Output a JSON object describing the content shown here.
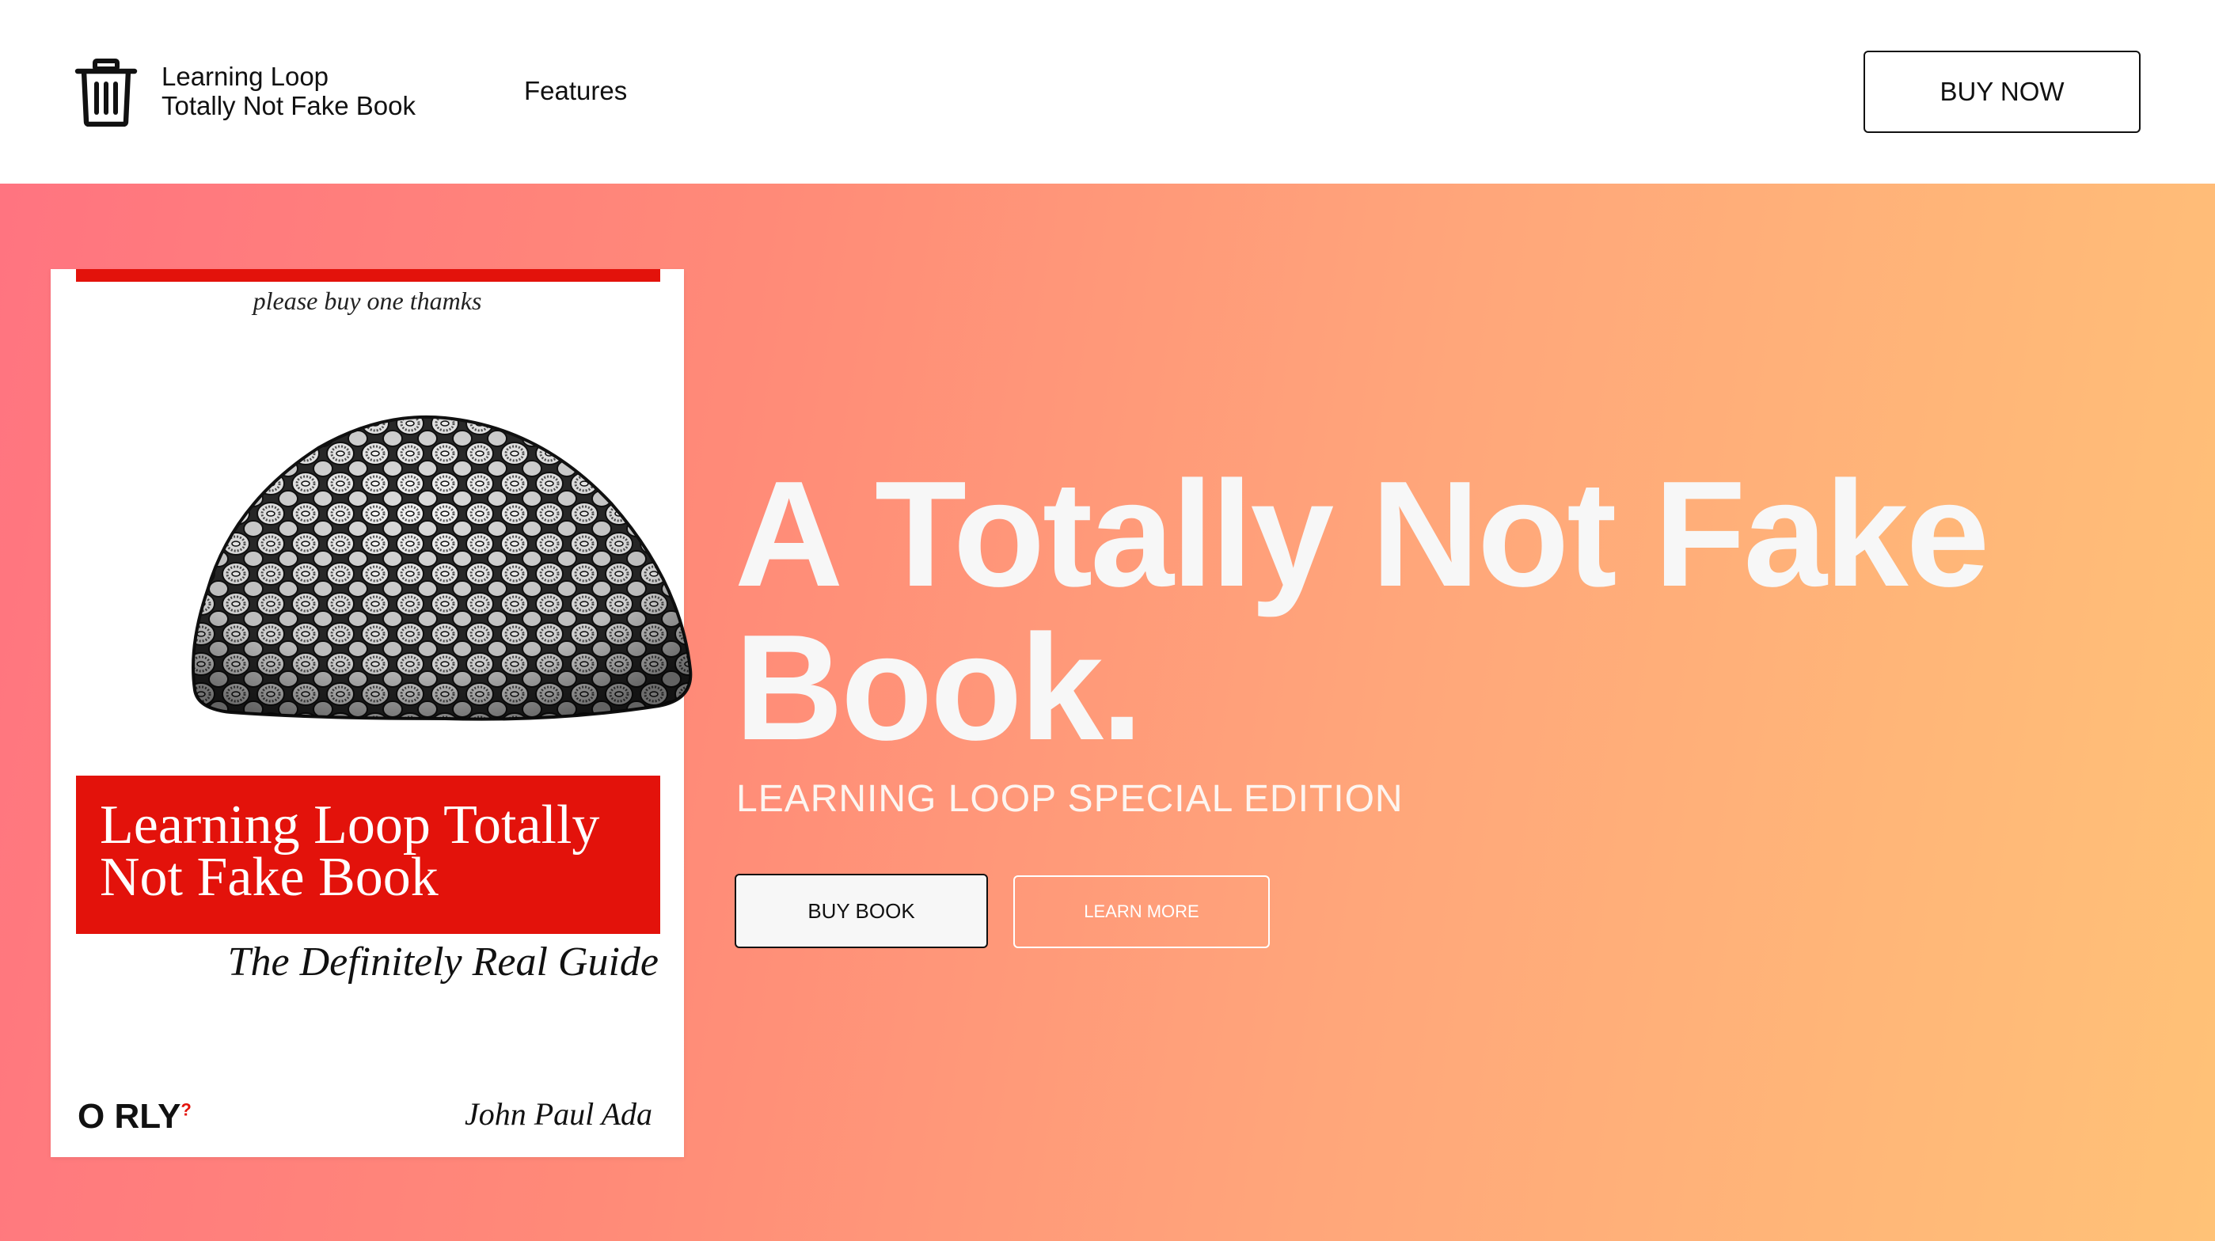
{
  "header": {
    "brand_line1": "Learning Loop",
    "brand_line2": "Totally Not Fake Book",
    "logo_icon": "trash-can-icon",
    "nav_features": "Features",
    "buy_now": "BUY NOW"
  },
  "book": {
    "tagline": "please buy one thamks",
    "title": "Learning Loop Totally Not Fake Book",
    "subtitle": "The Definitely Real Guide",
    "publisher": "O RLY",
    "publisher_mark": "?",
    "author": "John Paul Ada",
    "accent_color": "#e3120b"
  },
  "hero": {
    "title": "A Totally Not Fake Book.",
    "subtitle": "LEARNING LOOP SPECIAL EDITION",
    "buy_book": "BUY BOOK",
    "learn_more": "LEARN MORE",
    "gradient_start": "#ff7480",
    "gradient_end": "#ffc277"
  }
}
